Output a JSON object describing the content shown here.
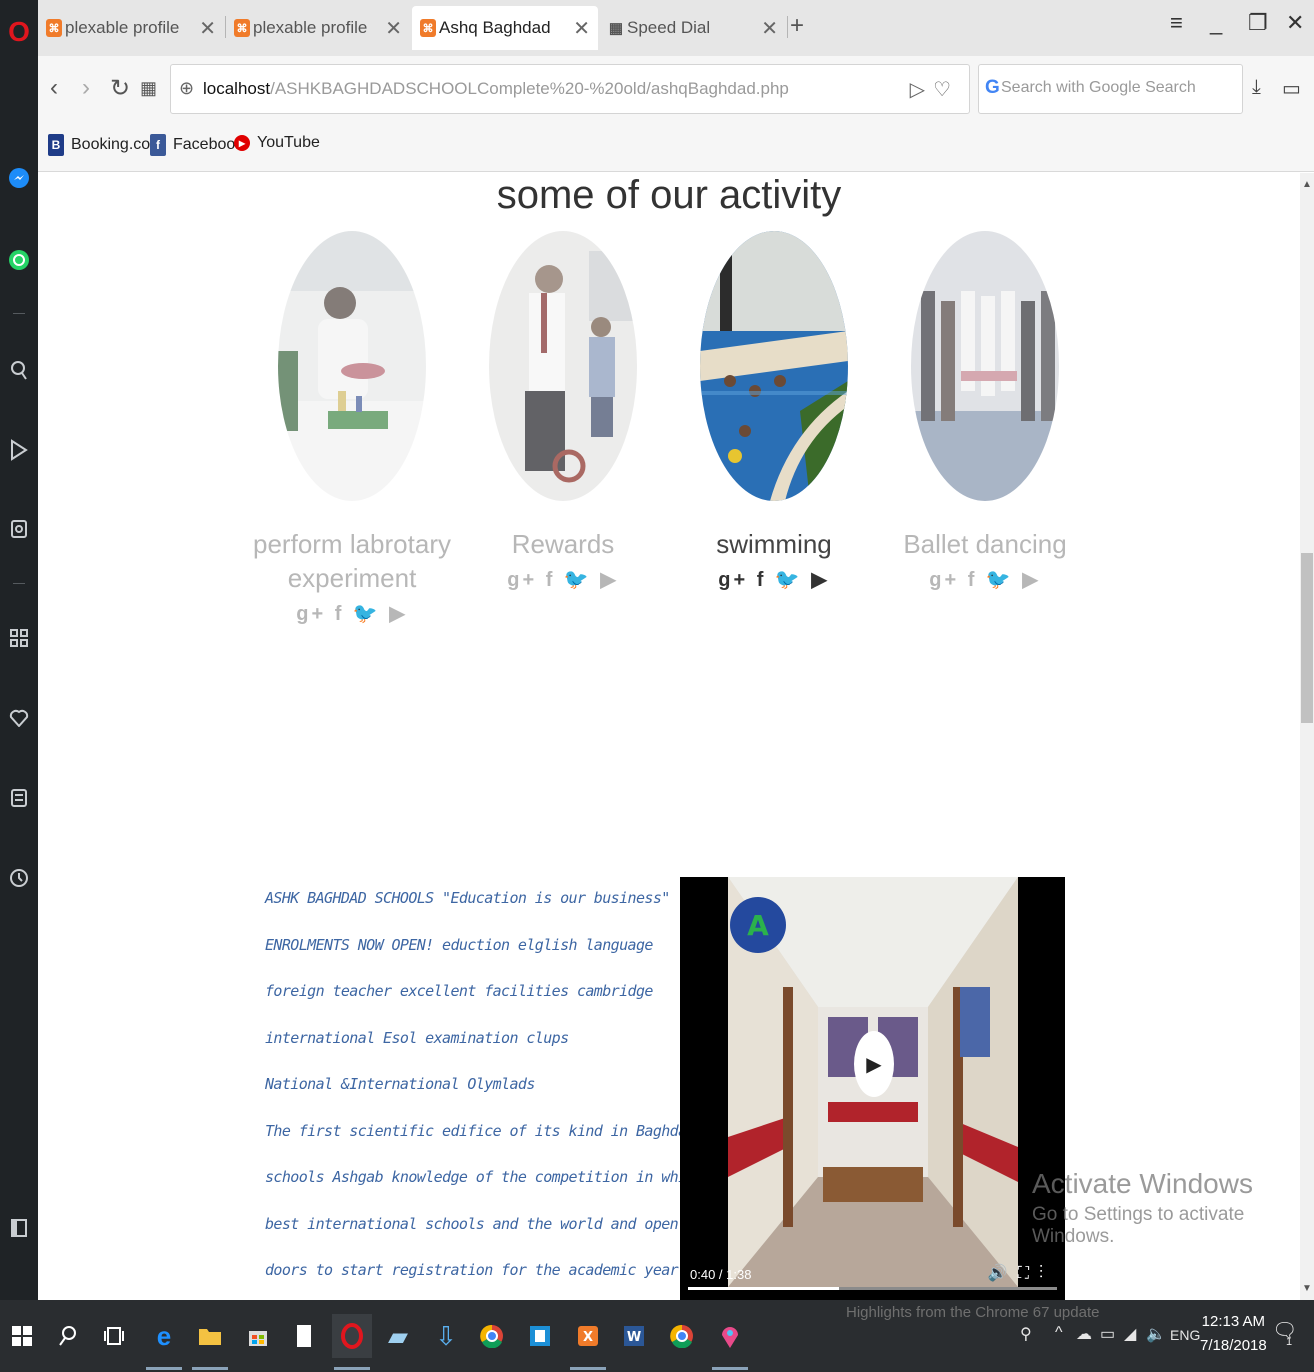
{
  "browser": {
    "tabs": [
      {
        "label": "plexable profile",
        "active": false
      },
      {
        "label": "plexable profile",
        "active": false
      },
      {
        "label": "Ashq Baghdad",
        "active": true
      },
      {
        "label": "Speed Dial",
        "active": false
      }
    ],
    "new_tab": "+",
    "address": {
      "host": "localhost",
      "path": "/ASHKBAGHDADSCHOOLComplete%20-%20old/ashqBaghdad.php"
    },
    "search_placeholder": "Search with Google Search",
    "bookmarks": [
      {
        "label": "Booking.com",
        "icon": "booking-icon",
        "color": "#1f3c88"
      },
      {
        "label": "Facebook",
        "icon": "facebook-icon",
        "color": "#3b5998"
      },
      {
        "label": "YouTube",
        "icon": "youtube-icon",
        "color": "#e00000"
      }
    ]
  },
  "page": {
    "section_title": "some of our activity",
    "activities": [
      {
        "caption": "perform labrotary experiment",
        "hovered": false
      },
      {
        "caption": "Rewards",
        "hovered": false
      },
      {
        "caption": "swimming",
        "hovered": true
      },
      {
        "caption": "Ballet dancing",
        "hovered": false
      }
    ],
    "social_glyphs": "g+ f 🐦 ▶",
    "promo_lines": [
      "ASHK BAGHDAD SCHOOLS \"Education is our business\"",
      "ENROLMENTS NOW OPEN! eduction elglish language",
      "foreign teacher excellent facilities cambridge",
      "international Esol examination clups",
      "National &International Olymlads",
      "The first scientific edifice of its kind in Baghdad",
      "schools Ashgab knowledge of the competition in which the",
      "best international schools and the world and open the",
      "doors to start registration for the academic year"
    ],
    "video": {
      "time": "0:40 / 1:38",
      "progress": 0.41
    },
    "watermark": {
      "title": "Activate Windows",
      "subtitle": "Go to Settings to activate Windows."
    }
  },
  "taskbar": {
    "tooltip": "Highlights from the Chrome 67 update",
    "language": "ENG",
    "time": "12:13 AM",
    "date": "7/18/2018",
    "notification_count": "1"
  },
  "colors": {
    "promo_text": "#3d66a3",
    "caption_inactive": "#b7b7b7",
    "caption_active": "#444444",
    "opera_red": "#e0161e",
    "xampp_orange": "#f07b2a"
  }
}
